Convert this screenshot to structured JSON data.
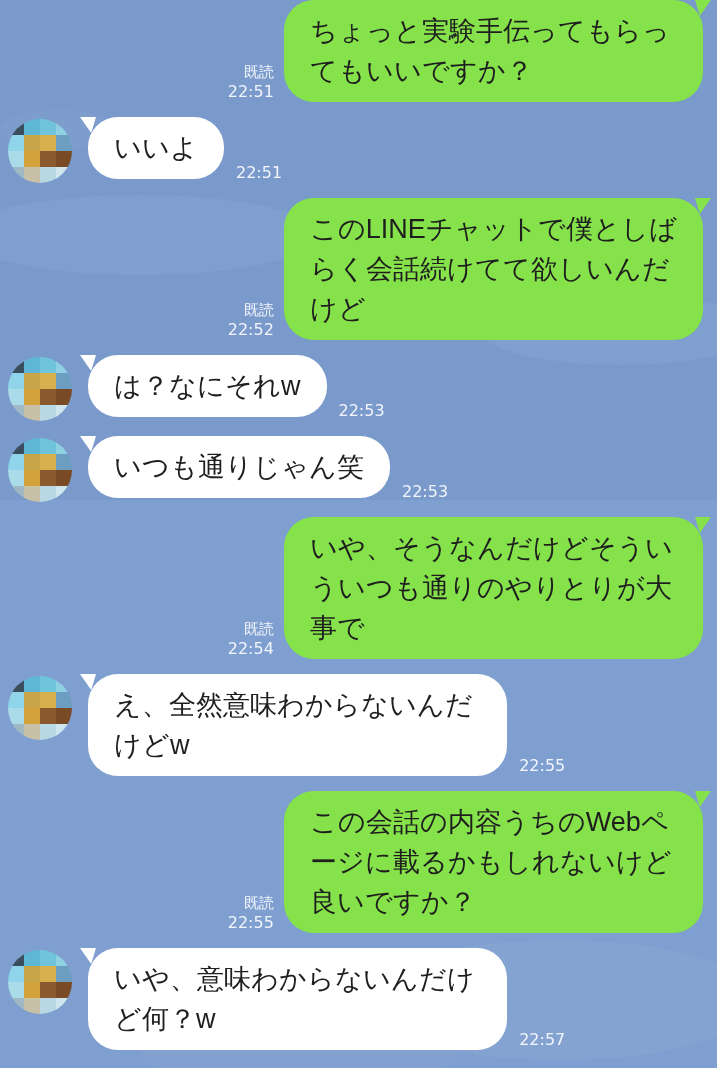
{
  "messages": [
    {
      "kind": "sent",
      "text": "ちょっと実験手伝ってもらってもいいですか？",
      "read_label": "既読",
      "time": "22:51"
    },
    {
      "kind": "received",
      "text": "いいよ",
      "time": "22:51"
    },
    {
      "kind": "sent",
      "text": "このLINEチャットで僕としばらく会話続けてて欲しいんだけど",
      "read_label": "既読",
      "time": "22:52"
    },
    {
      "kind": "received",
      "text": "は？なにそれw",
      "time": "22:53"
    },
    {
      "kind": "received",
      "text": "いつも通りじゃん笑",
      "time": "22:53"
    },
    {
      "kind": "sent",
      "text": "いや、そうなんだけどそういういつも通りのやりとりが大事で",
      "read_label": "既読",
      "time": "22:54"
    },
    {
      "kind": "received",
      "text": "え、全然意味わからないんだけどw",
      "time": "22:55"
    },
    {
      "kind": "sent",
      "text": "この会話の内容うちのWebページに載るかもしれないけど良いですか？",
      "read_label": "既読",
      "time": "22:55"
    },
    {
      "kind": "received",
      "text": "いや、意味わからないんだけど何？w",
      "time": "22:57"
    }
  ]
}
